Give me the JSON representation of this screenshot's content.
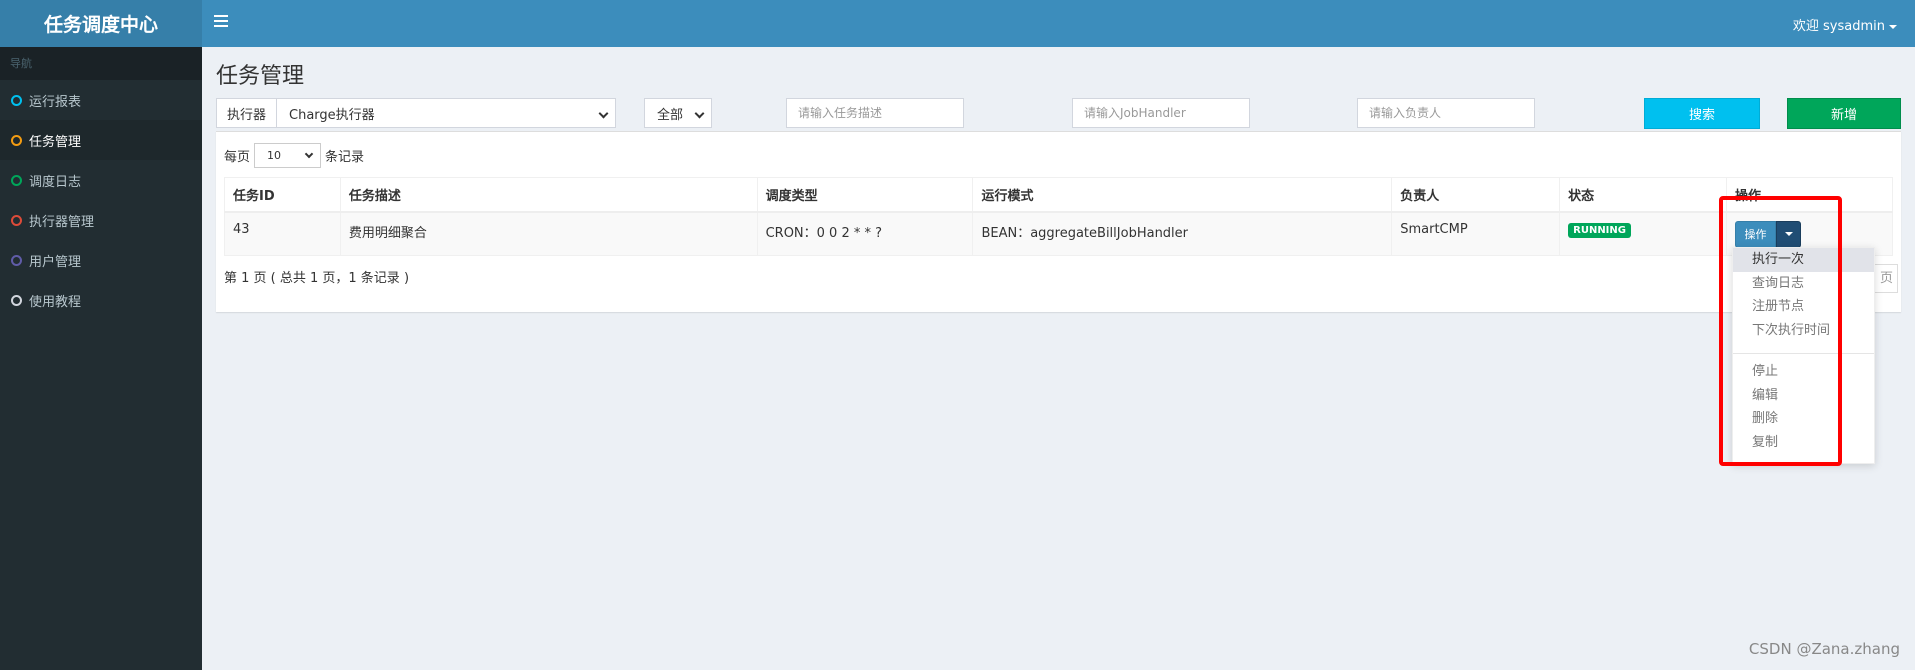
{
  "app": {
    "title": "任务调度中心"
  },
  "header": {
    "user_label": "欢迎 sysadmin"
  },
  "sidebar": {
    "header": "导航",
    "items": [
      {
        "label": "运行报表",
        "color": "#00c0ef"
      },
      {
        "label": "任务管理",
        "color": "#f39c12"
      },
      {
        "label": "调度日志",
        "color": "#00a65a"
      },
      {
        "label": "执行器管理",
        "color": "#dd4b39"
      },
      {
        "label": "用户管理",
        "color": "#605ca8"
      },
      {
        "label": "使用教程",
        "color": "#d2d6de"
      }
    ]
  },
  "page": {
    "title": "任务管理"
  },
  "filters": {
    "executor_label": "执行器",
    "executor_value": "Charge执行器",
    "status_value": "全部",
    "desc_placeholder": "请输入任务描述",
    "handler_placeholder": "请输入JobHandler",
    "author_placeholder": "请输入负责人",
    "search_label": "搜索",
    "add_label": "新增"
  },
  "perpage": {
    "prefix": "每页",
    "value": "10",
    "suffix": "条记录"
  },
  "table": {
    "headers": [
      "任务ID",
      "任务描述",
      "调度类型",
      "运行模式",
      "负责人",
      "状态",
      "操作"
    ],
    "rows": [
      {
        "id": "43",
        "desc": "费用明细聚合",
        "schedule": "CRON：0 0 2 * * ?",
        "mode": "BEAN：aggregateBillJobHandler",
        "author": "SmartCMP",
        "status": "RUNNING",
        "op_label": "操作"
      }
    ]
  },
  "pager": {
    "summary": "第 1 页 ( 总共 1 页，1 条记录 )",
    "next_partial": "页"
  },
  "dropdown": {
    "group1": [
      "执行一次",
      "查询日志",
      "注册节点",
      "下次执行时间"
    ],
    "group2": [
      "停止",
      "编辑",
      "删除",
      "复制"
    ]
  },
  "watermark": "CSDN @Zana.zhang"
}
